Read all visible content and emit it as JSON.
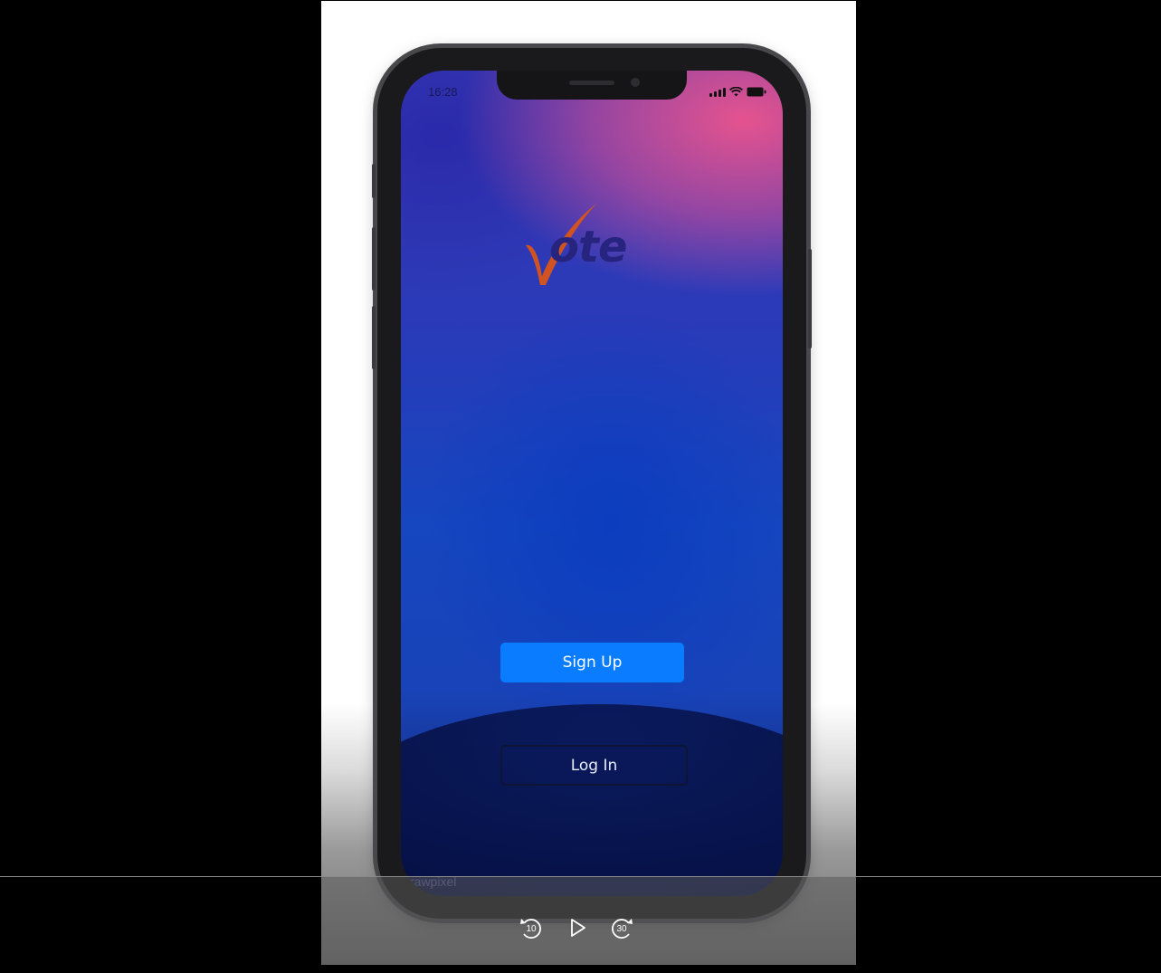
{
  "app": {
    "status_time": "16:28",
    "logo_text": "ote",
    "logo_brand": "Vote",
    "signup_label": "Sign Up",
    "login_label": "Log In",
    "watermark": "rawpixel"
  },
  "player": {
    "rewind_label": "10",
    "forward_label": "30",
    "play_icon": "play-icon"
  },
  "colors": {
    "signup_button": "#0a7cff",
    "logo_text": "#26247e",
    "logo_check": "#d1531f"
  }
}
